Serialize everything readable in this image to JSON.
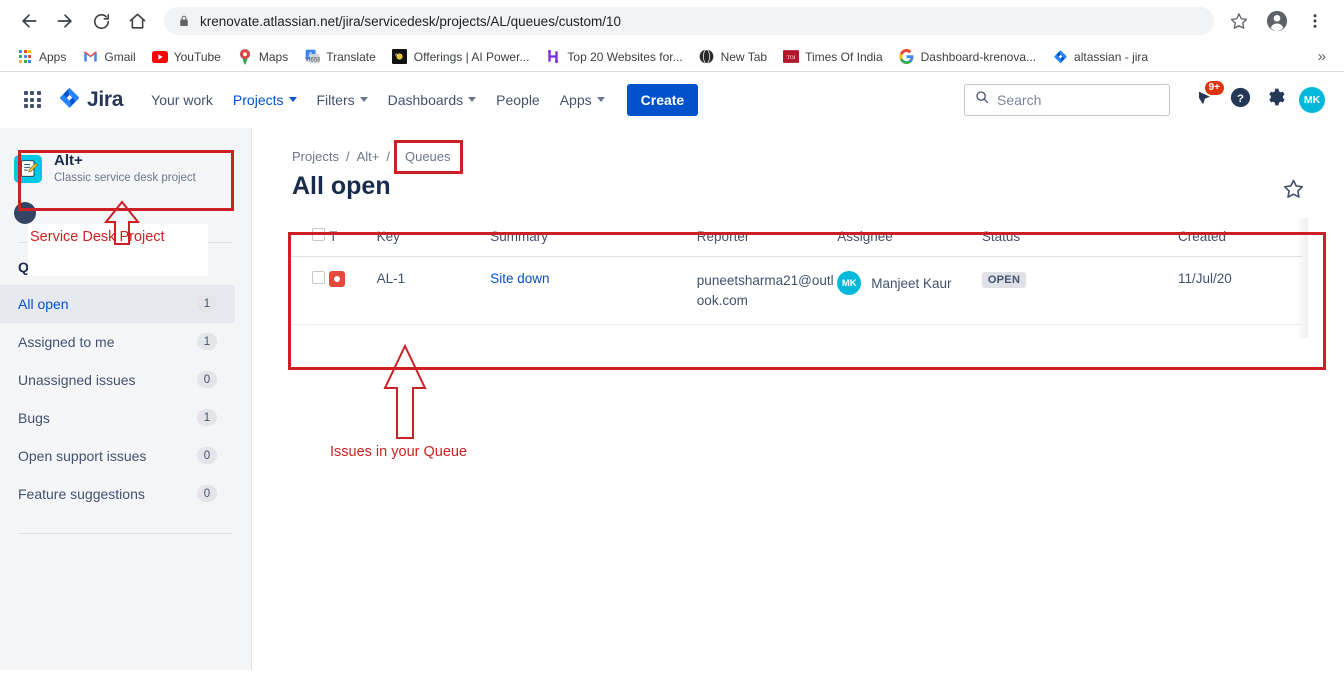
{
  "browser": {
    "url": "krenovate.atlassian.net/jira/servicedesk/projects/AL/queues/custom/10",
    "back_label": "Back",
    "forward_label": "Forward",
    "reload_label": "Reload",
    "home_label": "Home",
    "bookmark_star_label": "Bookmark this tab",
    "profile_label": "Profile",
    "menu_label": "Customize and control Google Chrome",
    "bookmarks": [
      {
        "label": "Apps",
        "icon": "apps-grid-icon"
      },
      {
        "label": "Gmail",
        "icon": "gmail-icon"
      },
      {
        "label": "YouTube",
        "icon": "youtube-icon"
      },
      {
        "label": "Maps",
        "icon": "maps-pin-icon"
      },
      {
        "label": "Translate",
        "icon": "translate-icon"
      },
      {
        "label": "Offerings | AI Power...",
        "icon": "offerings-icon"
      },
      {
        "label": "Top 20 Websites for...",
        "icon": "hootsuite-icon"
      },
      {
        "label": "New Tab",
        "icon": "globe-icon"
      },
      {
        "label": "Times Of India",
        "icon": "times-of-india-icon"
      },
      {
        "label": "Dashboard-krenova...",
        "icon": "google-icon"
      },
      {
        "label": "altassian - jira",
        "icon": "jira-icon"
      }
    ],
    "bookmarks_overflow": "»"
  },
  "topnav": {
    "app_switcher_label": "App switcher",
    "product_name": "Jira",
    "items": [
      {
        "label": "Your work",
        "has_caret": false,
        "active": false
      },
      {
        "label": "Projects",
        "has_caret": true,
        "active": true
      },
      {
        "label": "Filters",
        "has_caret": true,
        "active": false
      },
      {
        "label": "Dashboards",
        "has_caret": true,
        "active": false
      },
      {
        "label": "People",
        "has_caret": false,
        "active": false
      },
      {
        "label": "Apps",
        "has_caret": true,
        "active": false
      }
    ],
    "create_label": "Create",
    "search_placeholder": "Search",
    "notifications_badge": "9+",
    "notifications_label": "Notifications",
    "help_label": "Help",
    "settings_label": "Settings",
    "account_initials": "MK"
  },
  "sidebar": {
    "project_name": "Alt+",
    "project_type": "Classic service desk project",
    "section_heading": "Queues",
    "queues": [
      {
        "label": "All open",
        "count": "1",
        "selected": true
      },
      {
        "label": "Assigned to me",
        "count": "1",
        "selected": false
      },
      {
        "label": "Unassigned issues",
        "count": "0",
        "selected": false
      },
      {
        "label": "Bugs",
        "count": "1",
        "selected": false
      },
      {
        "label": "Open support issues",
        "count": "0",
        "selected": false
      },
      {
        "label": "Feature suggestions",
        "count": "0",
        "selected": false
      }
    ]
  },
  "breadcrumb": {
    "projects": "Projects",
    "project": "Alt+",
    "current": "Queues",
    "separator": "/"
  },
  "page": {
    "title": "All open",
    "star_label": "Add to starred"
  },
  "table": {
    "headers": {
      "checkbox": "",
      "type": "T",
      "key": "Key",
      "summary": "Summary",
      "reporter": "Reporter",
      "assignee": "Assignee",
      "status": "Status",
      "created": "Created"
    },
    "rows": [
      {
        "type_icon": "bug-icon",
        "key": "AL-1",
        "summary": "Site down",
        "reporter": "puneetsharma21@outlook.com",
        "assignee": "Manjeet Kaur",
        "assignee_initials": "MK",
        "status": "OPEN",
        "created": "11/Jul/20"
      }
    ]
  },
  "annotations": {
    "color": "#cc2026",
    "project_label": "Service Desk Project",
    "queue_label": "Issues in your Queue"
  }
}
